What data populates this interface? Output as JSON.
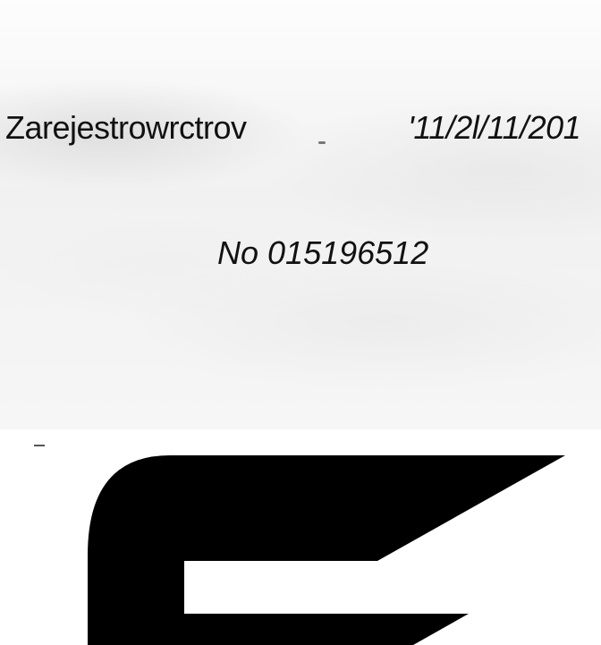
{
  "registration": {
    "label": "Zarejestrowrctrov",
    "date": "'11/2l/11/201"
  },
  "certificate": {
    "number": "No 015196512"
  },
  "logo": {
    "icon": "stylized-e-logo-icon",
    "color": "#000000"
  },
  "background": {
    "style": "grey-cloud-gradient"
  }
}
